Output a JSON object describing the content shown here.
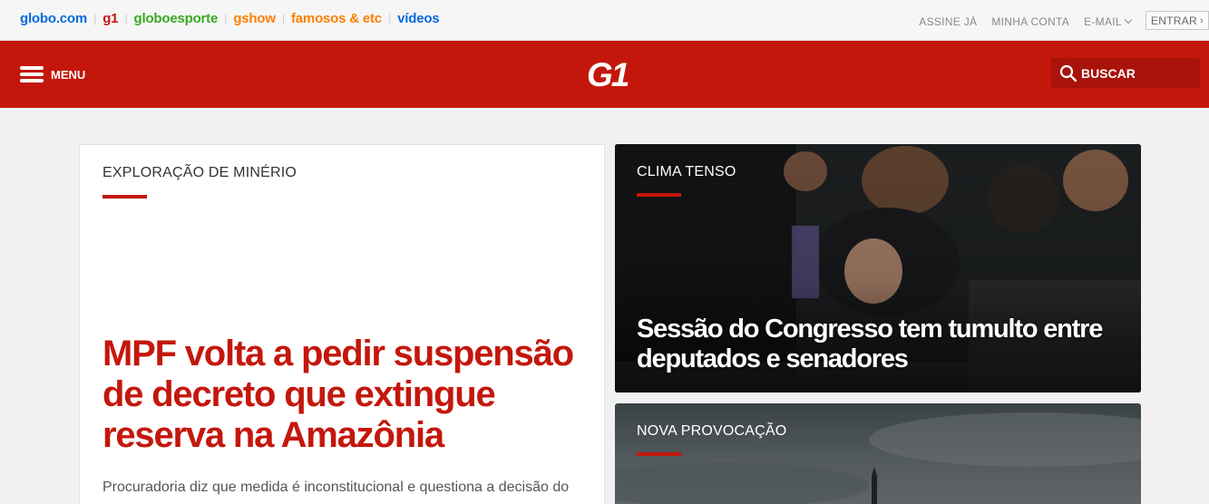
{
  "topbar": {
    "links": [
      {
        "label": "globo.com",
        "color": "#0669de"
      },
      {
        "label": "g1",
        "color": "#c4170c"
      },
      {
        "label": "globoesporte",
        "color": "#39a821"
      },
      {
        "label": "gshow",
        "color": "#ff7f00"
      },
      {
        "label": "famosos & etc",
        "color": "#ff7f00"
      },
      {
        "label": "vídeos",
        "color": "#0669de"
      }
    ],
    "assine": "ASSINE JÁ",
    "minha_conta": "MINHA CONTA",
    "email": "E-MAIL",
    "entrar": "ENTRAR"
  },
  "header": {
    "menu_label": "MENU",
    "logo_text": "G1",
    "search_label": "BUSCAR",
    "brand_color": "#c4170c"
  },
  "main_story": {
    "kicker": "EXPLORAÇÃO DE MINÉRIO",
    "headline": "MPF volta a pedir suspensão de decreto que extingue reserva na Amazônia",
    "summary": "Procuradoria diz que medida é inconstitucional e questiona a decisão do"
  },
  "photo_story_1": {
    "kicker": "CLIMA TENSO",
    "headline": "Sessão do Congresso tem tumulto entre deputados e senadores"
  },
  "photo_story_2": {
    "kicker": "NOVA PROVOCAÇÃO"
  }
}
